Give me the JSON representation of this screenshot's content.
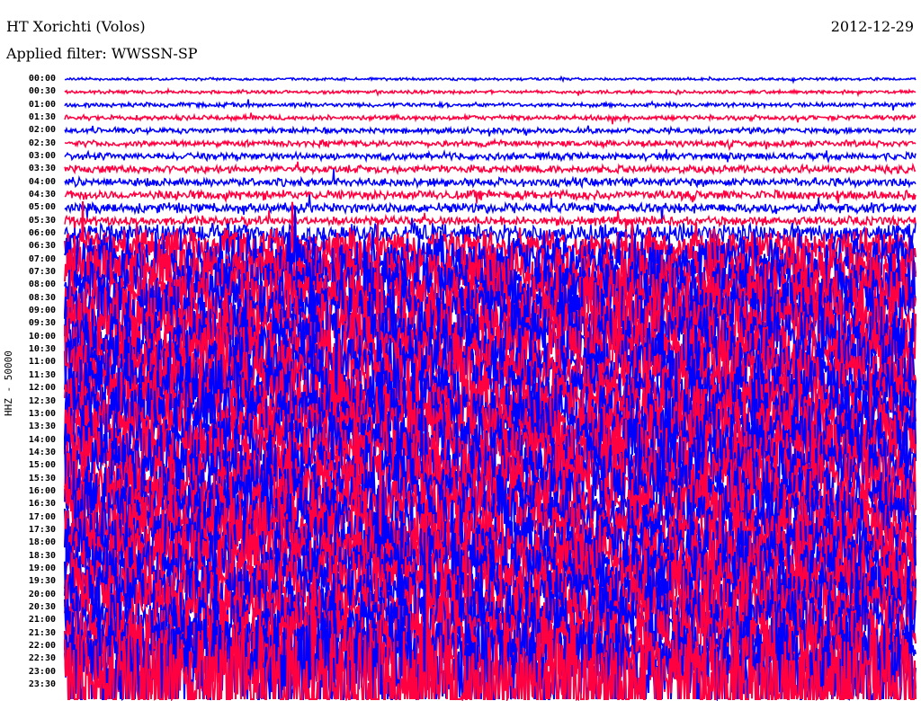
{
  "header": {
    "station": "HT Xorichti (Volos)",
    "date": "2012-12-29",
    "filter": "Applied filter: WWSSN-SP"
  },
  "chart_data": {
    "type": "line",
    "title": "HT Xorichti (Volos)",
    "subtitle": "Applied filter: WWSSN-SP",
    "ylabel": "HHZ - 50000",
    "xlabel": "",
    "colors": [
      "#0000ff",
      "#ff0040"
    ],
    "row_labels": [
      "00:00",
      "00:30",
      "01:00",
      "01:30",
      "02:00",
      "02:30",
      "03:00",
      "03:30",
      "04:00",
      "04:30",
      "05:00",
      "05:30",
      "06:00",
      "06:30",
      "07:00",
      "07:30",
      "08:00",
      "08:30",
      "09:00",
      "09:30",
      "10:00",
      "10:30",
      "11:00",
      "11:30",
      "12:00",
      "12:30",
      "13:00",
      "13:30",
      "14:00",
      "14:30",
      "15:00",
      "15:30",
      "16:00",
      "16:30",
      "17:00",
      "17:30",
      "18:00",
      "18:30",
      "19:00",
      "19:30",
      "20:00",
      "20:30",
      "21:00",
      "21:30",
      "22:00",
      "22:30",
      "23:00",
      "23:30"
    ],
    "relative_amplitude": [
      0.12,
      0.15,
      0.2,
      0.22,
      0.25,
      0.28,
      0.32,
      0.35,
      0.38,
      0.42,
      0.45,
      0.4,
      0.9,
      1.6,
      2.4,
      2.6,
      2.8,
      3.0,
      3.0,
      3.0,
      3.0,
      3.0,
      3.0,
      3.0,
      3.0,
      3.0,
      3.0,
      3.0,
      3.0,
      3.0,
      3.0,
      3.0,
      3.0,
      3.0,
      3.0,
      3.0,
      3.0,
      3.0,
      3.0,
      3.0,
      3.0,
      3.0,
      3.0,
      3.0,
      3.0,
      3.2,
      5.0,
      6.0
    ]
  }
}
